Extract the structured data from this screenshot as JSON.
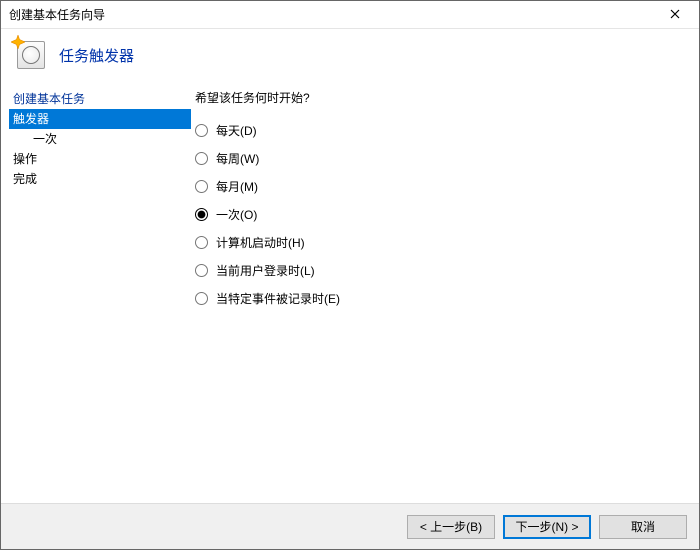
{
  "window": {
    "title": "创建基本任务向导"
  },
  "header": {
    "heading": "任务触发器"
  },
  "sidebar": {
    "items": [
      {
        "label": "创建基本任务",
        "cls": "item"
      },
      {
        "label": "触发器",
        "cls": "item selected"
      },
      {
        "label": "一次",
        "cls": "item indent"
      },
      {
        "label": "操作",
        "cls": "item plain"
      },
      {
        "label": "完成",
        "cls": "item plain"
      }
    ]
  },
  "content": {
    "prompt": "希望该任务何时开始?",
    "options": [
      {
        "label": "每天(D)",
        "selected": false
      },
      {
        "label": "每周(W)",
        "selected": false
      },
      {
        "label": "每月(M)",
        "selected": false
      },
      {
        "label": "一次(O)",
        "selected": true
      },
      {
        "label": "计算机启动时(H)",
        "selected": false
      },
      {
        "label": "当前用户登录时(L)",
        "selected": false
      },
      {
        "label": "当特定事件被记录时(E)",
        "selected": false
      }
    ]
  },
  "footer": {
    "back": "< 上一步(B)",
    "next": "下一步(N) >",
    "cancel": "取消"
  }
}
